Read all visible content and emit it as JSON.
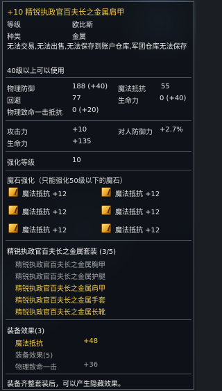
{
  "header": {
    "enhance": "+10",
    "name": "精锐执政官百夫长之金属肩甲"
  },
  "info": [
    {
      "label": "等级",
      "value": "欧比斯"
    },
    {
      "label": "种类",
      "value": "金属"
    }
  ],
  "restriction_text": "无法交易,无法出售,无法保存到账户仓库,军团仓库无法保存",
  "level_req": "40级以上可以使用",
  "stats": [
    {
      "label": "物理防御",
      "value": "188 (+40)"
    },
    {
      "label": "回避",
      "value": "77"
    },
    {
      "label": "物理致命一击抵抗",
      "value": "0 (+20)"
    }
  ],
  "stats_right": [
    {
      "label": "魔法抵抗",
      "value": "55"
    },
    {
      "label": "生命力",
      "value": "0 (+40)"
    }
  ],
  "bonus": [
    {
      "label": "攻击力",
      "value": "+10",
      "label2": "对人防御力",
      "value2": "+2.7%"
    },
    {
      "label": "生命力",
      "value": "+135"
    }
  ],
  "enchant": {
    "label": "强化等级",
    "value": "10"
  },
  "manastone": {
    "title": "魔石强化（只能强化50级以下的魔石）",
    "slots": [
      {
        "text": "魔法抵抗 +12"
      },
      {
        "text": "魔法抵抗 +12"
      },
      {
        "text": "魔法抵抗 +12"
      },
      {
        "text": "魔法抵抗 +12"
      },
      {
        "text": "魔法抵抗 +12"
      },
      {
        "text": "魔法抵抗 +12"
      }
    ]
  },
  "set": {
    "title": "精锐执政官百夫长之金属套装 (3/5)",
    "items": [
      {
        "name": "精锐执政官百夫长之金属胸甲",
        "owned": false
      },
      {
        "name": "精锐执政官百夫长之金属护腿",
        "owned": false
      },
      {
        "name": "精锐执政官百夫长之金属肩甲",
        "owned": true
      },
      {
        "name": "精锐执政官百夫长之金属手套",
        "owned": true
      },
      {
        "name": "精锐执政官百夫长之金属长靴",
        "owned": true
      }
    ]
  },
  "effects": {
    "title": "装备效果(3)",
    "e3": {
      "label": "魔法抵抗",
      "value": "+48"
    },
    "title5": "装备效果(5)",
    "e5": {
      "label": "物理致命一击",
      "value": "+36"
    }
  },
  "footer": "装备齐整套装后，可以产生隐藏效果。",
  "colors": {
    "gold": "#f0c94a",
    "gray": "#a3a3a3",
    "border": "#5b6674"
  }
}
